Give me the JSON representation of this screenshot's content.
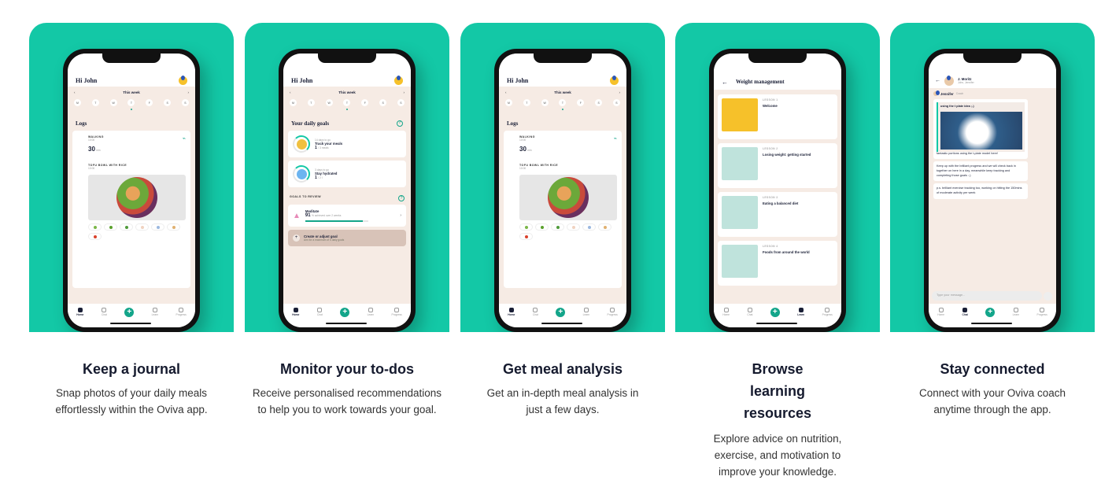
{
  "colors": {
    "brand": "#13c8a6",
    "accent": "#13a58a"
  },
  "days": [
    "M",
    "T",
    "W",
    "T",
    "F",
    "S",
    "S"
  ],
  "nav": [
    "Home",
    "Chat",
    "Learn",
    "Progress"
  ],
  "cards": [
    {
      "title": "Keep a journal",
      "desc": "Snap photos of your daily meals effortlessly within the Oviva app.",
      "screen": {
        "greeting": "Hi John",
        "week": "This week",
        "section": "Logs",
        "walk_label": "WALKING",
        "walk_time": "10:00",
        "walk_value": "30",
        "walk_unit": "min",
        "meal_label": "TOFU BOWL WITH RICE",
        "meal_time": "10:00"
      }
    },
    {
      "title": "Monitor your to-dos",
      "desc": "Receive personalised recommendations to help you to work towards your goal.",
      "screen": {
        "greeting": "Hi John",
        "week": "This week",
        "section": "Your daily goals",
        "goals": [
          {
            "sub": "14 days to go",
            "name": "Track your meals",
            "count": "1",
            "of": "/ 3 meals"
          },
          {
            "sub": "3 days to go",
            "name": "Stay hydrated",
            "count": "1",
            "of": "/ 2 l"
          }
        ],
        "review_label": "GOALS TO REVIEW",
        "review_name": "Meditate",
        "review_value": "91",
        "review_text": "% achieved over 2 weeks",
        "review_progress": 0.91,
        "create_title": "Create or adjust goal",
        "create_sub": "Aim for a maximum of 5 daily goals"
      }
    },
    {
      "title": "Get meal analysis",
      "desc": "Get an in-depth meal analysis in just a few days.",
      "screen": {
        "greeting": "Hi John",
        "week": "This week",
        "section": "Logs",
        "walk_label": "WALKING",
        "walk_time": "10:00",
        "walk_value": "30",
        "walk_unit": "min",
        "meal_label": "TOFU BOWL WITH RICE",
        "meal_time": "10:00"
      }
    },
    {
      "title": "Browse learning resources",
      "desc": "Explore advice on nutrition, exercise, and motivation to improve your knowledge.",
      "screen": {
        "header": "Weight management",
        "lessons": [
          {
            "num": "LESSON 1",
            "name": "Welcome"
          },
          {
            "num": "LESSON 2",
            "name": "Losing weight: getting started"
          },
          {
            "num": "LESSON 3",
            "name": "Eating a balanced diet"
          },
          {
            "num": "LESSON 4",
            "name": "Foods from around the world"
          }
        ]
      }
    },
    {
      "title": "Stay connected",
      "desc": "Connect with your Oviva coach anytime through the app.",
      "screen": {
        "name": "J. Moritz",
        "members": "John, Jennifer",
        "coach": "Jennifer",
        "coach_role": "Coach",
        "quote": "using the t plate idea ;-)",
        "messages": [
          "fantastic portions using the t-plate model here!",
          "Keep up with the brilliant progress and we will check back in together on here in a day, meanwhile keep tracking and completing those goals :-)",
          "p.s. brilliant exercise tracking too, working on hitting the 150mins of moderate activity per week"
        ],
        "placeholder": "Type your message..."
      }
    }
  ]
}
